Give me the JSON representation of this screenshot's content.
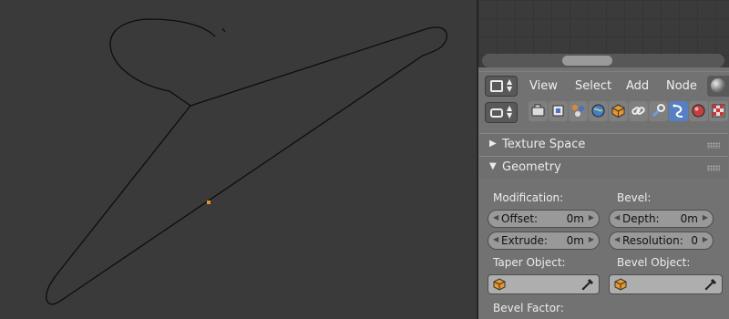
{
  "header": {
    "menu": [
      "View",
      "Select",
      "Add",
      "Node"
    ]
  },
  "context_tabs": [
    "render-icon",
    "render-layers-icon",
    "scene-icon",
    "world-icon",
    "object-icon",
    "constraints-icon",
    "modifiers-icon",
    "data-icon",
    "material-icon",
    "texture-icon"
  ],
  "panels": {
    "texture_space": {
      "title": "Texture Space",
      "expanded": false
    },
    "geometry": {
      "title": "Geometry",
      "expanded": true,
      "modification_label": "Modification:",
      "bevel_label": "Bevel:",
      "offset": {
        "label": "Offset:",
        "value": "0m"
      },
      "extrude": {
        "label": "Extrude:",
        "value": "0m"
      },
      "depth": {
        "label": "Depth:",
        "value": "0m"
      },
      "resolution": {
        "label": "Resolution:",
        "value": "0"
      },
      "taper_object_label": "Taper Object:",
      "bevel_object_label": "Bevel Object:",
      "bevel_factor_label": "Bevel Factor:"
    }
  },
  "colors": {
    "viewport_bg": "#3a3a3a",
    "panel_bg": "#727272",
    "active_tab": "#5680c2",
    "origin": "#e8902c"
  }
}
